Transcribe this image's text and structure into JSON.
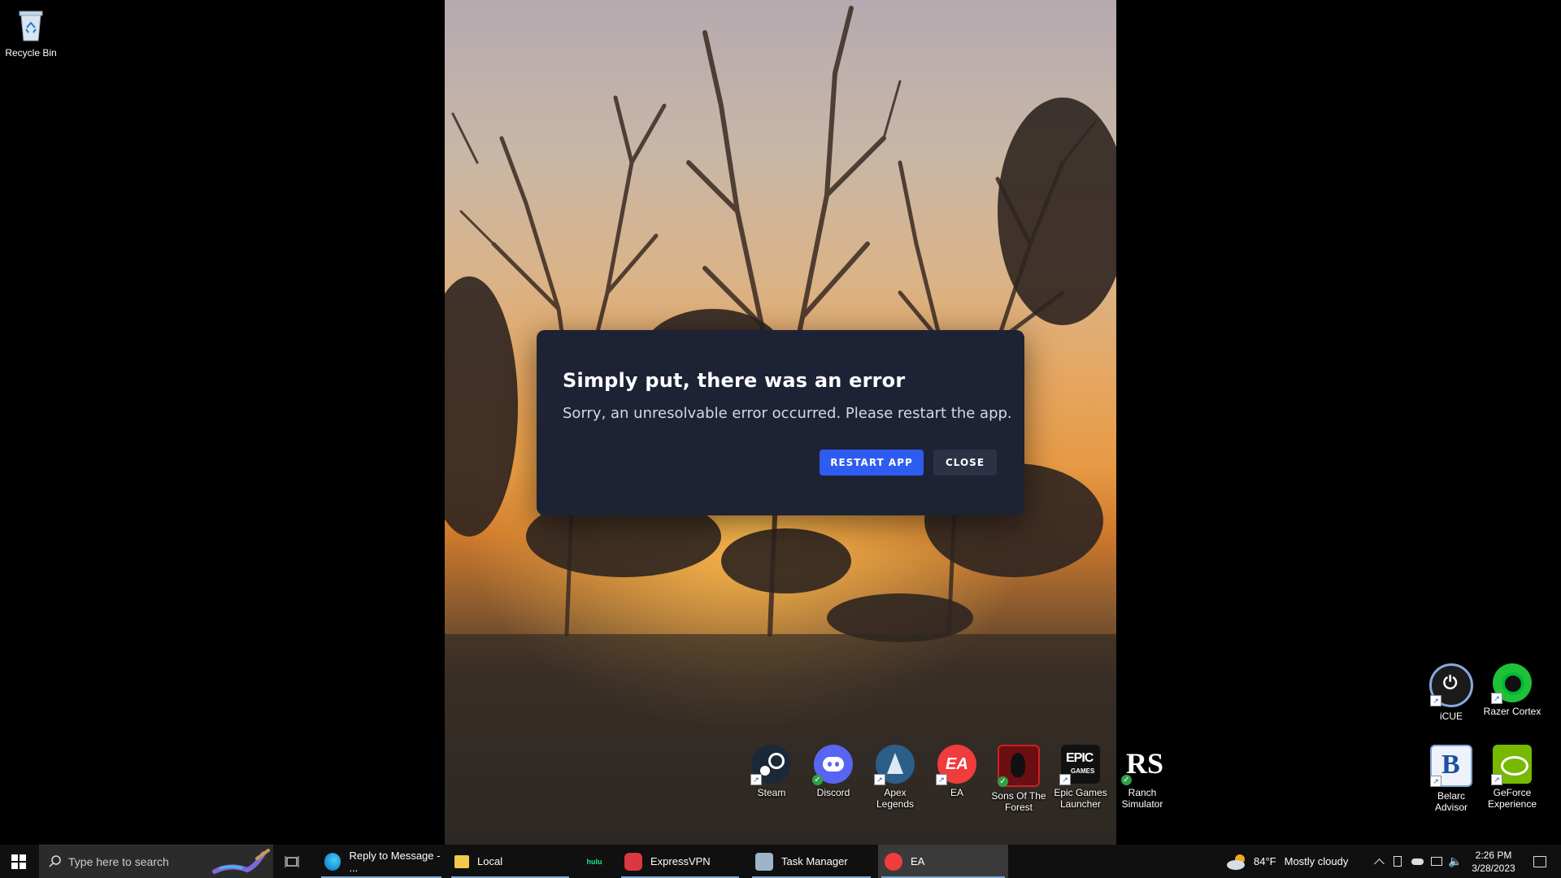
{
  "desktop": {
    "recycle_bin": "Recycle Bin",
    "icons_right": [
      {
        "label": "iCUE"
      },
      {
        "label": "Razer Cortex"
      },
      {
        "label": "Belarc Advisor"
      },
      {
        "label": "GeForce Experience"
      }
    ],
    "icons_row": [
      {
        "label": "Steam"
      },
      {
        "label": "Discord"
      },
      {
        "label": "Apex Legends"
      },
      {
        "label": "EA"
      },
      {
        "label": "Sons Of The Forest"
      },
      {
        "label": "Epic Games Launcher"
      },
      {
        "label": "Ranch Simulator"
      }
    ]
  },
  "dialog": {
    "title": "Simply put, there was an error",
    "message": "Sorry, an unresolvable error occurred. Please restart the app.",
    "restart_label": "RESTART APP",
    "close_label": "CLOSE"
  },
  "taskbar": {
    "search_placeholder": "Type here to search",
    "apps": [
      {
        "label": "Reply to Message - ...",
        "icon": "edge-icon"
      },
      {
        "label": "Local",
        "icon": "folder-icon"
      },
      {
        "label": "",
        "icon": "hulu-icon"
      },
      {
        "label": "ExpressVPN",
        "icon": "expressvpn-icon"
      },
      {
        "label": "Task Manager",
        "icon": "task-manager-icon"
      },
      {
        "label": "EA",
        "icon": "ea-icon"
      }
    ],
    "hulu_icon_text": "hulu",
    "weather": {
      "temp": "84°F",
      "condition": "Mostly cloudy"
    },
    "time": "2:26 PM",
    "date": "3/28/2023"
  },
  "colors": {
    "dialog_bg": "#1e2235",
    "restart_bg": "#2f5cf0",
    "close_bg": "#2c3146",
    "taskbar_bg": "#101010"
  }
}
